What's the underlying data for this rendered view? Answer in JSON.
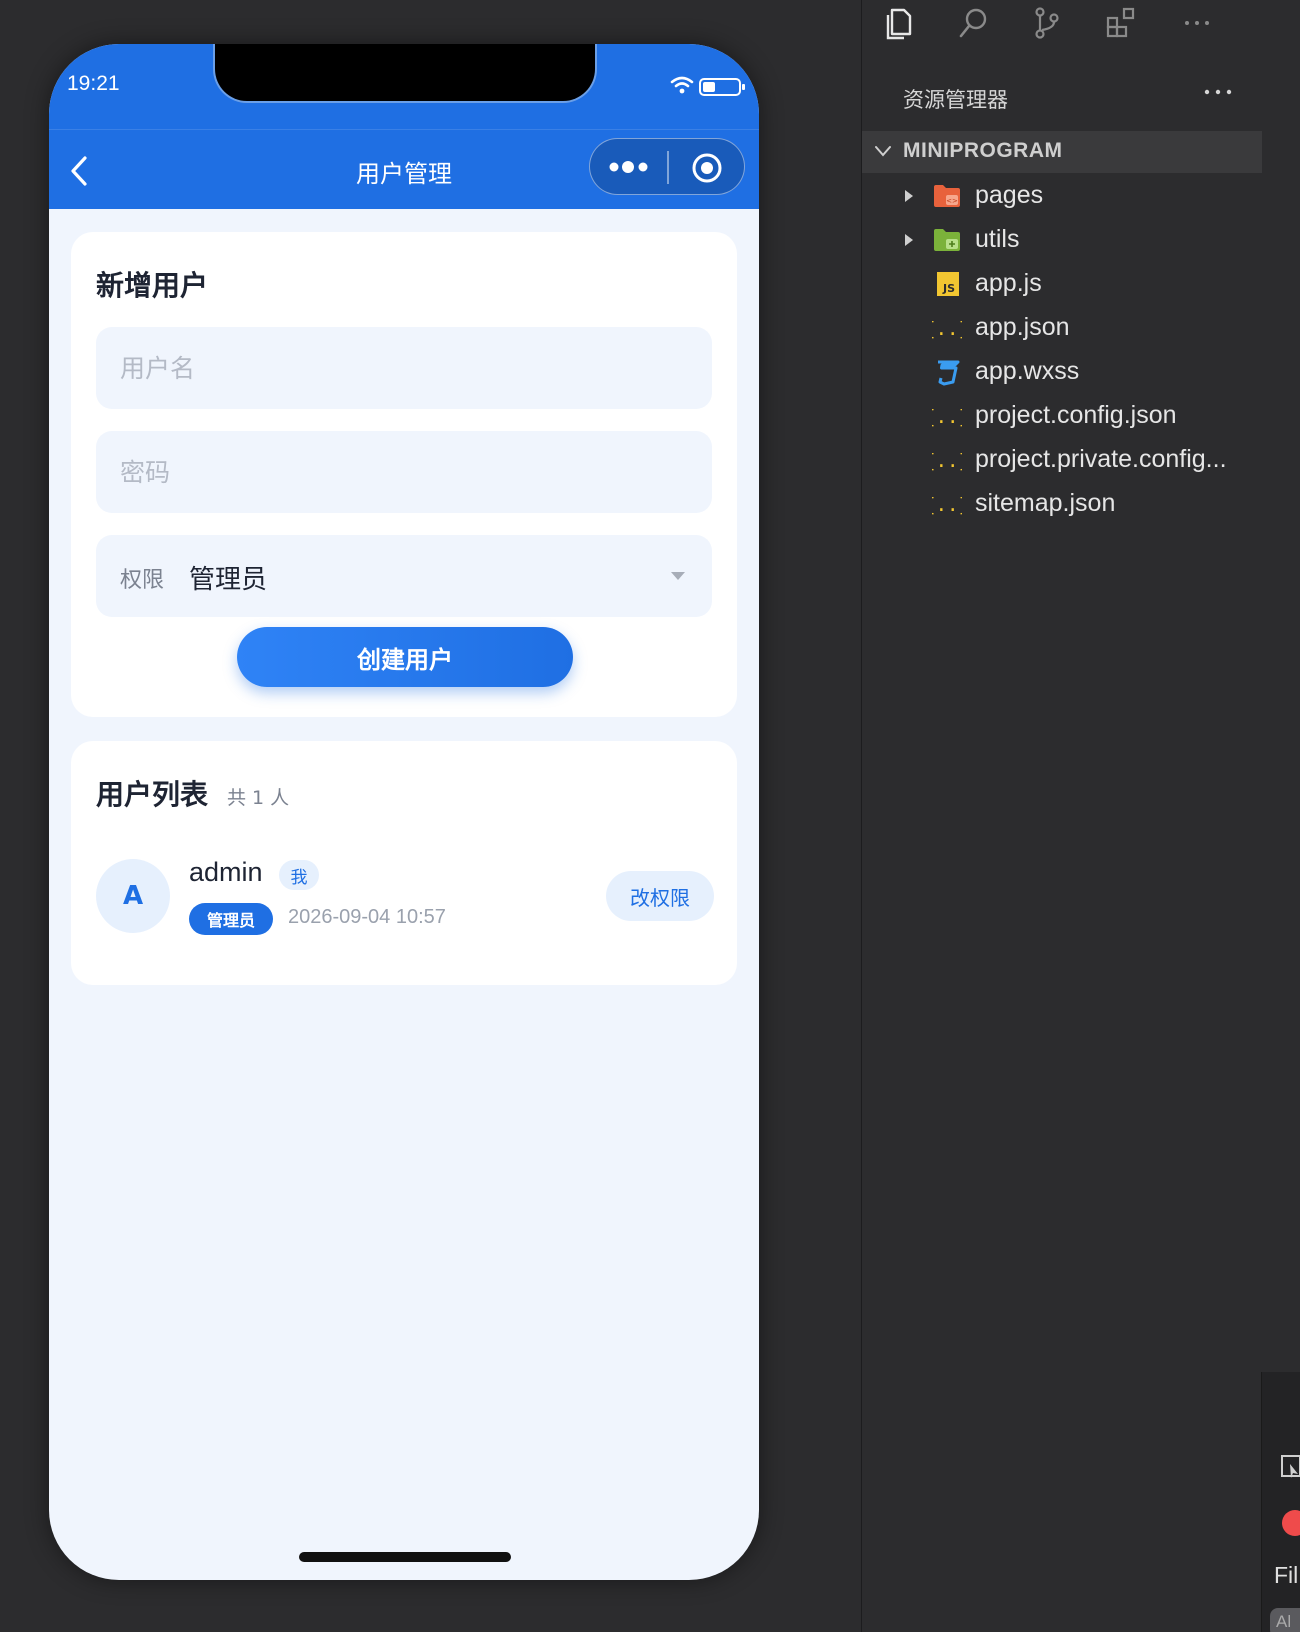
{
  "simulator": {
    "status_bar": {
      "time": "19:21"
    },
    "nav": {
      "title": "用户管理"
    },
    "add_user_card": {
      "title": "新增用户",
      "username_placeholder": "用户名",
      "password_placeholder": "密码",
      "role_label": "权限",
      "role_value": "管理员",
      "create_button": "创建用户"
    },
    "user_list_card": {
      "title": "用户列表",
      "count": "共 1 人",
      "users": [
        {
          "avatar_letter": "A",
          "username": "admin",
          "me_badge": "我",
          "role_badge": "管理员",
          "created_at": "2026-09-04 10:57",
          "action": "改权限"
        }
      ]
    }
  },
  "explorer": {
    "title": "资源管理器",
    "section": "MINIPROGRAM",
    "items": [
      {
        "name": "pages",
        "icon": "folder-pages-icon",
        "folder": true
      },
      {
        "name": "utils",
        "icon": "folder-utils-icon",
        "folder": true
      },
      {
        "name": "app.js",
        "icon": "js-file-icon",
        "folder": false
      },
      {
        "name": "app.json",
        "icon": "json-file-icon",
        "folder": false
      },
      {
        "name": "app.wxss",
        "icon": "css-file-icon",
        "folder": false
      },
      {
        "name": "project.config.json",
        "icon": "json-file-icon",
        "folder": false
      },
      {
        "name": "project.private.config...",
        "icon": "json-file-icon",
        "folder": false
      },
      {
        "name": "sitemap.json",
        "icon": "json-file-icon",
        "folder": false
      }
    ],
    "edge_panel": {
      "filter_label": "Fil",
      "chip": "Al"
    }
  },
  "colors": {
    "brand_blue": "#1f6fe3",
    "page_bg": "#f0f5fd",
    "ide_bg": "#2c2c2e"
  }
}
